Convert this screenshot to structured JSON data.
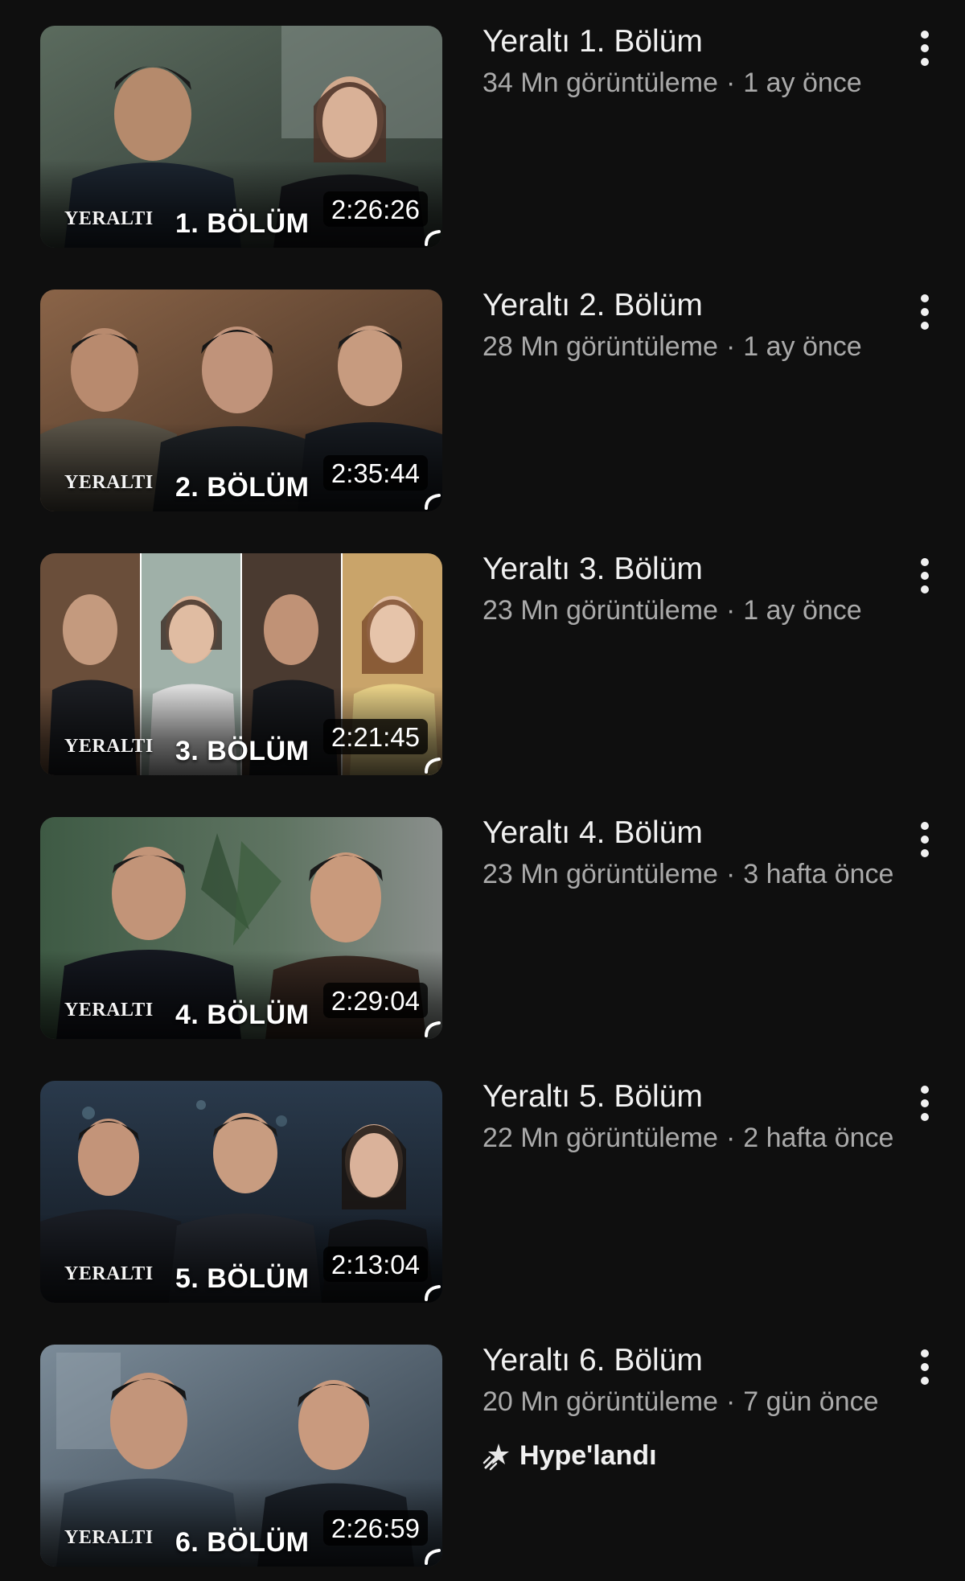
{
  "videos": [
    {
      "title": "Yeraltı 1. Bölüm",
      "views": "34 Mn görüntüleme",
      "age": "1 ay önce",
      "duration": "2:26:26",
      "thumb_logo": "YERALTI",
      "thumb_label": "1. BÖLÜM",
      "thumb_colors": [
        "#3b4a3f",
        "#6e7d72"
      ]
    },
    {
      "title": "Yeraltı 2. Bölüm",
      "views": "28 Mn görüntüleme",
      "age": "1 ay önce",
      "duration": "2:35:44",
      "thumb_logo": "YERALTI",
      "thumb_label": "2. BÖLÜM",
      "thumb_colors": [
        "#5a3e2a",
        "#8a6448"
      ]
    },
    {
      "title": "Yeraltı 3. Bölüm",
      "views": "23 Mn görüntüleme",
      "age": "1 ay önce",
      "duration": "2:21:45",
      "thumb_logo": "YERALTI",
      "thumb_label": "3. BÖLÜM",
      "thumb_colors": [
        "#7a5a40",
        "#c9b07a"
      ]
    },
    {
      "title": "Yeraltı 4. Bölüm",
      "views": "23 Mn görüntüleme",
      "age": "3 hafta önce",
      "duration": "2:29:04",
      "thumb_logo": "YERALTI",
      "thumb_label": "4. BÖLÜM",
      "thumb_colors": [
        "#2f4a36",
        "#5c6e62"
      ]
    },
    {
      "title": "Yeraltı 5. Bölüm",
      "views": "22 Mn görüntüleme",
      "age": "2 hafta önce",
      "duration": "2:13:04",
      "thumb_logo": "YERALTI",
      "thumb_label": "5. BÖLÜM",
      "thumb_colors": [
        "#1f2c3a",
        "#3d4f63"
      ]
    },
    {
      "title": "Yeraltı 6. Bölüm",
      "views": "20 Mn görüntüleme",
      "age": "7 gün önce",
      "duration": "2:26:59",
      "thumb_logo": "YERALTI",
      "thumb_label": "6. BÖLÜM",
      "thumb_colors": [
        "#3a4a58",
        "#6f808e"
      ],
      "hype_label": "Hype'landı"
    }
  ],
  "icons": {
    "menu": "more-vertical-icon",
    "hype": "hype-icon"
  },
  "colors": {
    "background": "#0f0f0f",
    "title": "#f1f1f1",
    "meta": "#aaaaaa",
    "duration_bg": "#000000"
  }
}
